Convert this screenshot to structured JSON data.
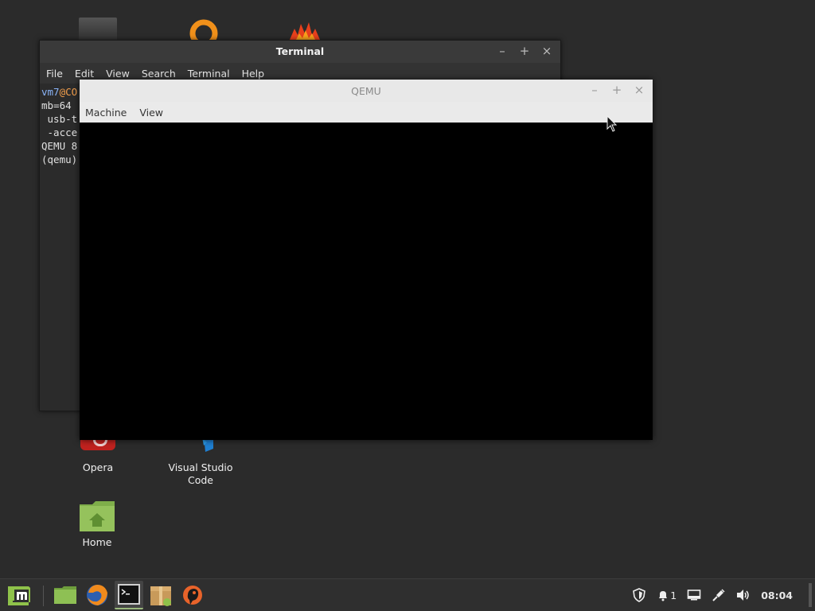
{
  "desktop": {
    "icons": [
      {
        "label": "Opera"
      },
      {
        "label": "Visual Studio Code"
      },
      {
        "label": "Home"
      }
    ]
  },
  "terminal": {
    "title": "Terminal",
    "menu": [
      "File",
      "Edit",
      "View",
      "Search",
      "Terminal",
      "Help"
    ],
    "lines": [
      {
        "user": "vm7",
        "at": "@",
        "host": "CO"
      },
      {
        "text": "mb=64"
      },
      {
        "text": " usb-t"
      },
      {
        "text": " -acce"
      },
      {
        "text": "QEMU 8"
      },
      {
        "text": "(qemu)"
      }
    ]
  },
  "qemu": {
    "title": "QEMU",
    "menu": [
      "Machine",
      "View"
    ]
  },
  "window_controls": {
    "minimize": "–",
    "maximize": "+",
    "close": "×"
  },
  "taskbar": {
    "clock": "08:04",
    "notification_count": "1"
  },
  "colors": {
    "desktop_bg": "#2b2b2b",
    "mint_green": "#8fc24a",
    "prompt_user": "#8ab4f8",
    "prompt_at": "#f29e4c"
  }
}
